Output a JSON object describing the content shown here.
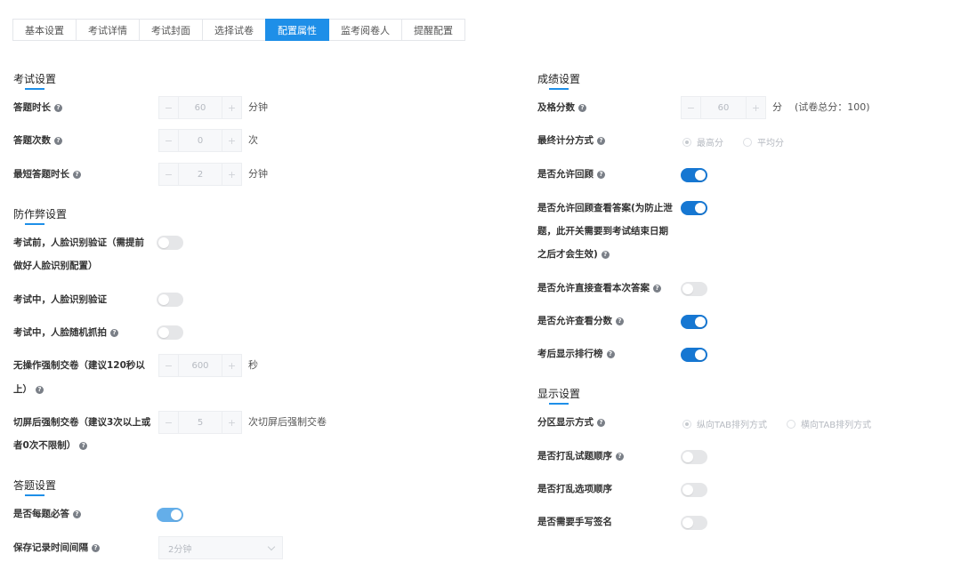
{
  "tabs": [
    "基本设置",
    "考试详情",
    "考试封面",
    "选择试卷",
    "配置属性",
    "监考阅卷人",
    "提醒配置"
  ],
  "active_tab": "配置属性",
  "exam": {
    "title": "考试设置",
    "duration": {
      "label": "答题时长",
      "value": "60",
      "unit": "分钟"
    },
    "attempts": {
      "label": "答题次数",
      "value": "0",
      "unit": "次"
    },
    "min_duration": {
      "label": "最短答题时长",
      "value": "2",
      "unit": "分钟"
    }
  },
  "anticheat": {
    "title": "防作弊设置",
    "face_before": {
      "label_line1": "考试前，人脸识别验证（需提前",
      "label_line2": "做好人脸识别配置）",
      "on": false
    },
    "face_during": {
      "label": "考试中，人脸识别验证",
      "on": false
    },
    "face_snap": {
      "label": "考试中，人脸随机抓拍",
      "on": false
    },
    "idle_submit": {
      "label_line1": "无操作强制交卷（建议120秒以",
      "label_line2": "上）",
      "value": "600",
      "unit": "秒"
    },
    "switch_submit": {
      "label_line1": "切屏后强制交卷（建议3次以上或",
      "label_line2": "者0次不限制）",
      "value": "5",
      "unit": "次切屏后强制交卷"
    }
  },
  "answer": {
    "title": "答题设置",
    "must_answer": {
      "label": "是否每题必答",
      "on": true
    },
    "save_interval": {
      "label": "保存记录时间间隔",
      "value": "2分钟"
    }
  },
  "score": {
    "title": "成绩设置",
    "pass_score": {
      "label": "及格分数",
      "value": "60",
      "unit": "分",
      "note": "(试卷总分：100)"
    },
    "final_method": {
      "label": "最终计分方式",
      "options": [
        "最高分",
        "平均分"
      ],
      "selected": "最高分"
    },
    "allow_review": {
      "label": "是否允许回顾",
      "on": true
    },
    "review_answer": {
      "label_line1": "是否允许回顾查看答案(为防止泄",
      "label_line2": "题，此开关需要到考试结束日期",
      "label_line3": "之后才会生效)",
      "on": true
    },
    "view_answer_direct": {
      "label": "是否允许直接查看本次答案",
      "on": false
    },
    "view_score": {
      "label": "是否允许查看分数",
      "on": true
    },
    "leaderboard": {
      "label": "考后显示排行榜",
      "on": true
    }
  },
  "display": {
    "title": "显示设置",
    "partition": {
      "label": "分区显示方式",
      "options": [
        "纵向TAB排列方式",
        "横向TAB排列方式"
      ],
      "selected": "纵向TAB排列方式"
    },
    "shuffle_questions": {
      "label": "是否打乱试题顺序",
      "on": false
    },
    "shuffle_options": {
      "label": "是否打乱选项顺序",
      "on": false
    },
    "signature": {
      "label": "是否需要手写签名",
      "on": false
    }
  },
  "icons": {
    "help": "question-circle-icon",
    "minus": "minus-icon",
    "plus": "plus-icon",
    "chevron": "chevron-down-icon"
  },
  "colors": {
    "accent": "#1e8fe8",
    "toggle_on": "#1677d2",
    "toggle_off": "#e5e6e8"
  }
}
